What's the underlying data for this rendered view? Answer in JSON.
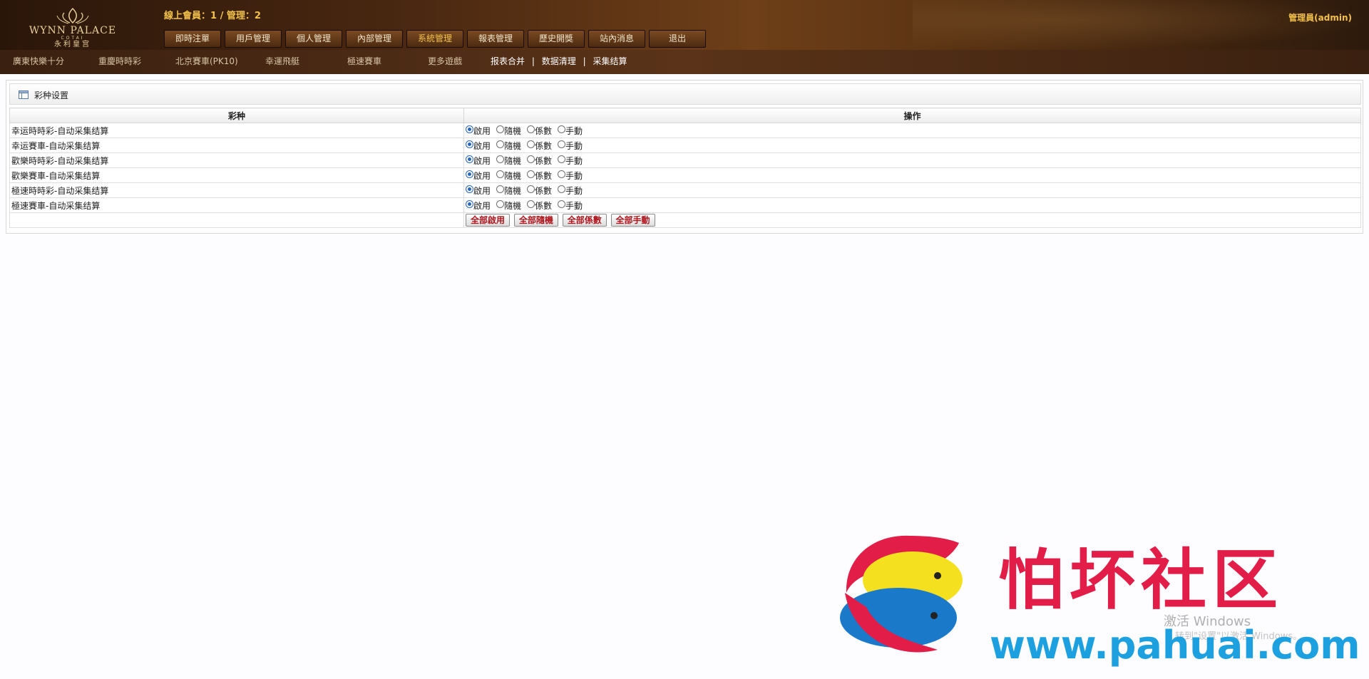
{
  "header": {
    "logo": {
      "name": "WYNN PALACE",
      "sub": "COTAI",
      "cn": "永利皇宫"
    },
    "online_text": "線上會員：1 / 管理：2",
    "admin_text": "管理員(admin)",
    "nav": [
      {
        "label": "即時注單"
      },
      {
        "label": "用戶管理"
      },
      {
        "label": "個人管理"
      },
      {
        "label": "內部管理"
      },
      {
        "label": "系統管理",
        "active": true
      },
      {
        "label": "報表管理"
      },
      {
        "label": "歷史開獎"
      },
      {
        "label": "站內消息"
      },
      {
        "label": "退出"
      }
    ]
  },
  "subnav": {
    "games": [
      "廣東快樂十分",
      "重慶時時彩",
      "北京賽車(PK10)",
      "幸運飛艇",
      "極速賽車",
      "更多遊戲"
    ],
    "links": [
      "报表合并",
      "数据清理",
      "采集结算"
    ]
  },
  "panel": {
    "title": "彩种设置",
    "columns": [
      "彩种",
      "操作"
    ],
    "options": [
      "啟用",
      "隨機",
      "係數",
      "手動"
    ],
    "rows": [
      {
        "name": "幸运時時彩-自动采集结算",
        "selected": 0
      },
      {
        "name": "幸运賽車-自动采集结算",
        "selected": 0
      },
      {
        "name": "歡樂時時彩-自动采集结算",
        "selected": 0
      },
      {
        "name": "歡樂賽車-自动采集结算",
        "selected": 0
      },
      {
        "name": "極速時時彩-自动采集结算",
        "selected": 0
      },
      {
        "name": "極速賽車-自动采集结算",
        "selected": 0
      }
    ],
    "bulk_buttons": [
      "全部啟用",
      "全部隨機",
      "全部係數",
      "全部手動"
    ]
  },
  "os_notice": {
    "line1": "激活 Windows",
    "line2": "转到\"设置\"以激活 Windows。"
  },
  "watermark": {
    "cn": "怕坏社区",
    "url": "www.pahuai.com"
  },
  "colors": {
    "gold": "#f3c24a",
    "red_button_text": "#b0141c",
    "watermark_red": "#e11d48",
    "watermark_blue": "#1ca0e0"
  }
}
